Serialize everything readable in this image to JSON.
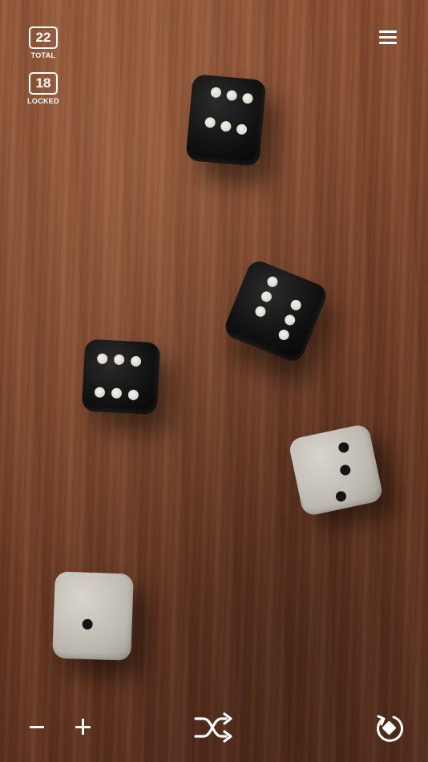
{
  "counters": {
    "total": {
      "value": "22",
      "label": "TOTAL"
    },
    "locked": {
      "value": "18",
      "label": "LOCKED"
    }
  },
  "dice": [
    {
      "id": "die-1",
      "color": "black",
      "value": 6
    },
    {
      "id": "die-2",
      "color": "black",
      "value": 6
    },
    {
      "id": "die-3",
      "color": "black",
      "value": 6
    },
    {
      "id": "die-4",
      "color": "white",
      "value": 3
    },
    {
      "id": "die-5",
      "color": "white",
      "value": 1
    }
  ],
  "icons": {
    "menu": "hamburger-icon",
    "decrease": "minus-icon",
    "increase": "plus-icon",
    "shuffle": "shuffle-icon",
    "reset": "reset-icon"
  },
  "colors": {
    "table_wood": "#7e462c",
    "die_black": "#111111",
    "die_white": "#c9c4bb",
    "ui_foreground": "#ffffff"
  }
}
